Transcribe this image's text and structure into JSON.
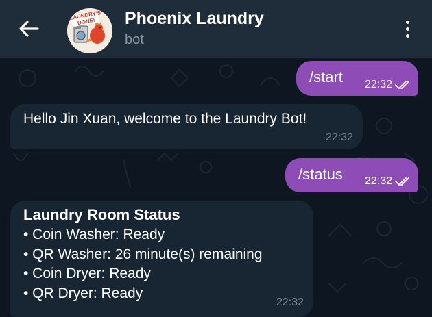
{
  "header": {
    "title": "Phoenix Laundry",
    "subtitle": "bot",
    "avatar_text": "LAUNDRY'S DONE!"
  },
  "messages": {
    "m1": {
      "text": "/start",
      "time": "22:32"
    },
    "m2": {
      "text": "Hello Jin Xuan, welcome to the Laundry Bot!",
      "time": "22:32"
    },
    "m3": {
      "text": "/status",
      "time": "22:32"
    },
    "m4": {
      "heading": "Laundry Room Status",
      "lines": [
        "• Coin Washer: Ready",
        "• QR Washer: 26 minute(s) remaining",
        "• Coin Dryer: Ready",
        "• QR Dryer: Ready"
      ],
      "time": "22:32"
    }
  },
  "colors": {
    "outgoing_bubble": "#8e4cb6",
    "incoming_bubble": "#182533",
    "header_bg": "#1f2c39",
    "chat_bg": "#0e1621"
  }
}
